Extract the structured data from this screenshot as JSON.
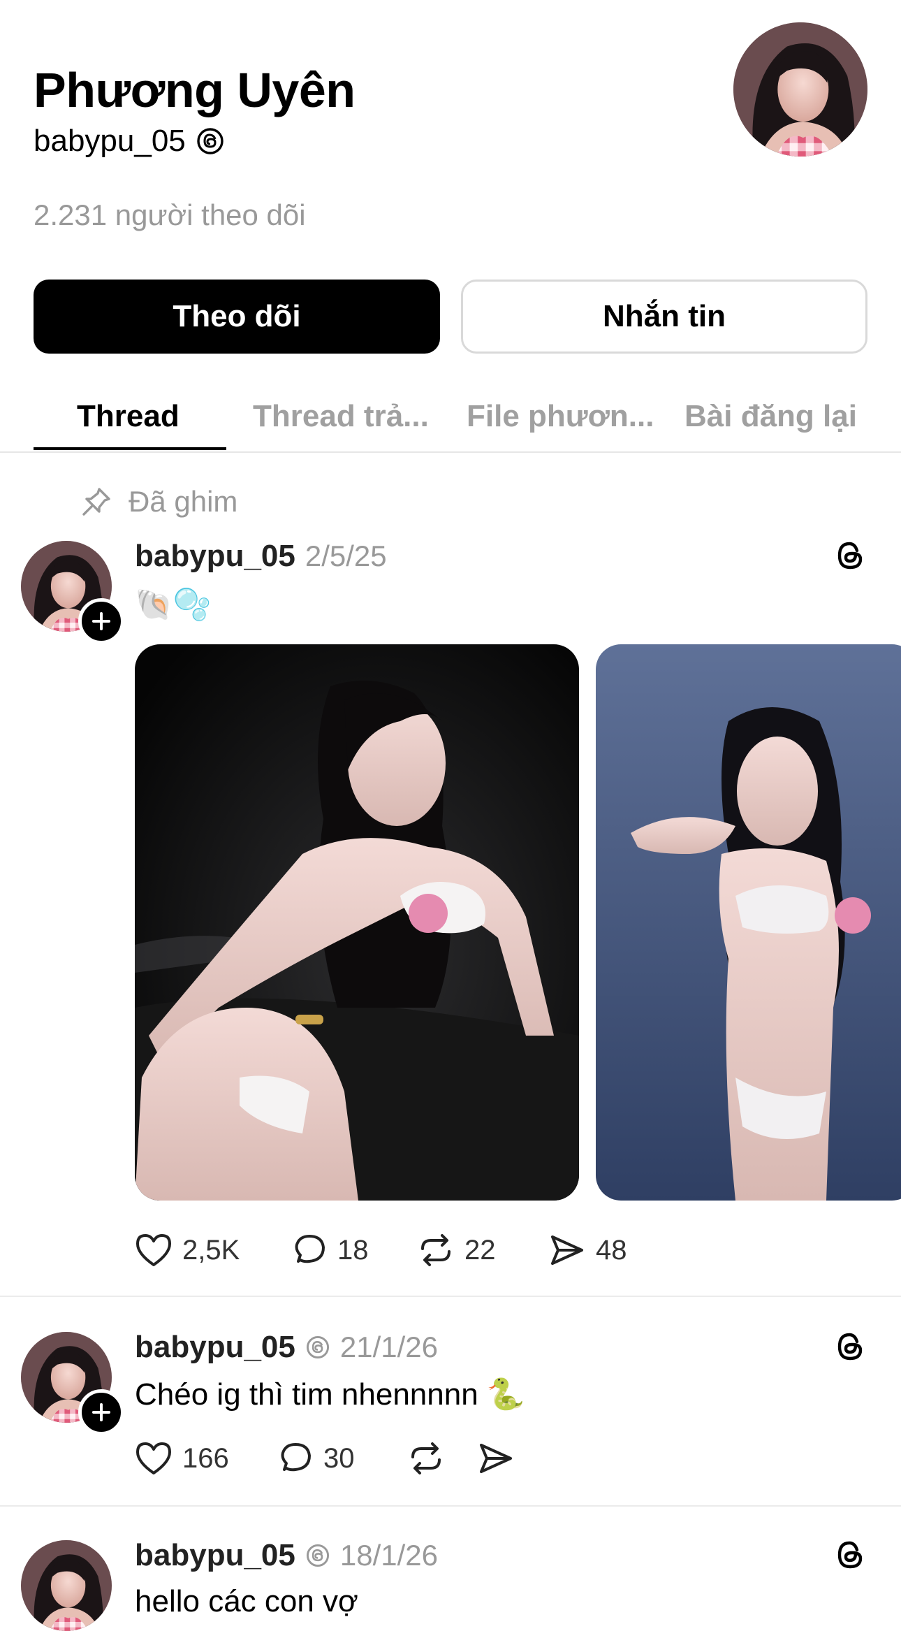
{
  "profile": {
    "display_name": "Phương Uyên",
    "handle": "babypu_05",
    "followers_text": "2.231 người theo dõi"
  },
  "buttons": {
    "follow_label": "Theo dõi",
    "message_label": "Nhắn tin"
  },
  "tabs": [
    {
      "label": "Thread",
      "active": true
    },
    {
      "label": "Thread trả...",
      "active": false
    },
    {
      "label": "File phươn...",
      "active": false
    },
    {
      "label": "Bài đăng lại",
      "active": false
    }
  ],
  "pinned_label": "Đã ghim",
  "posts": [
    {
      "username": "babypu_05",
      "date": "2/5/25",
      "text": "🐚🫧",
      "likes": "2,5K",
      "replies": "18",
      "reposts": "22",
      "shares": "48"
    },
    {
      "username": "babypu_05",
      "date": "21/1/26",
      "text": "Chéo ig thì tim nhennnnn 🐍",
      "likes": "166",
      "replies": "30"
    },
    {
      "username": "babypu_05",
      "date": "18/1/26",
      "text": "hello các con vợ"
    }
  ],
  "colors": {
    "primary": "#000000",
    "muted": "#999999",
    "divider": "#ebebeb"
  }
}
